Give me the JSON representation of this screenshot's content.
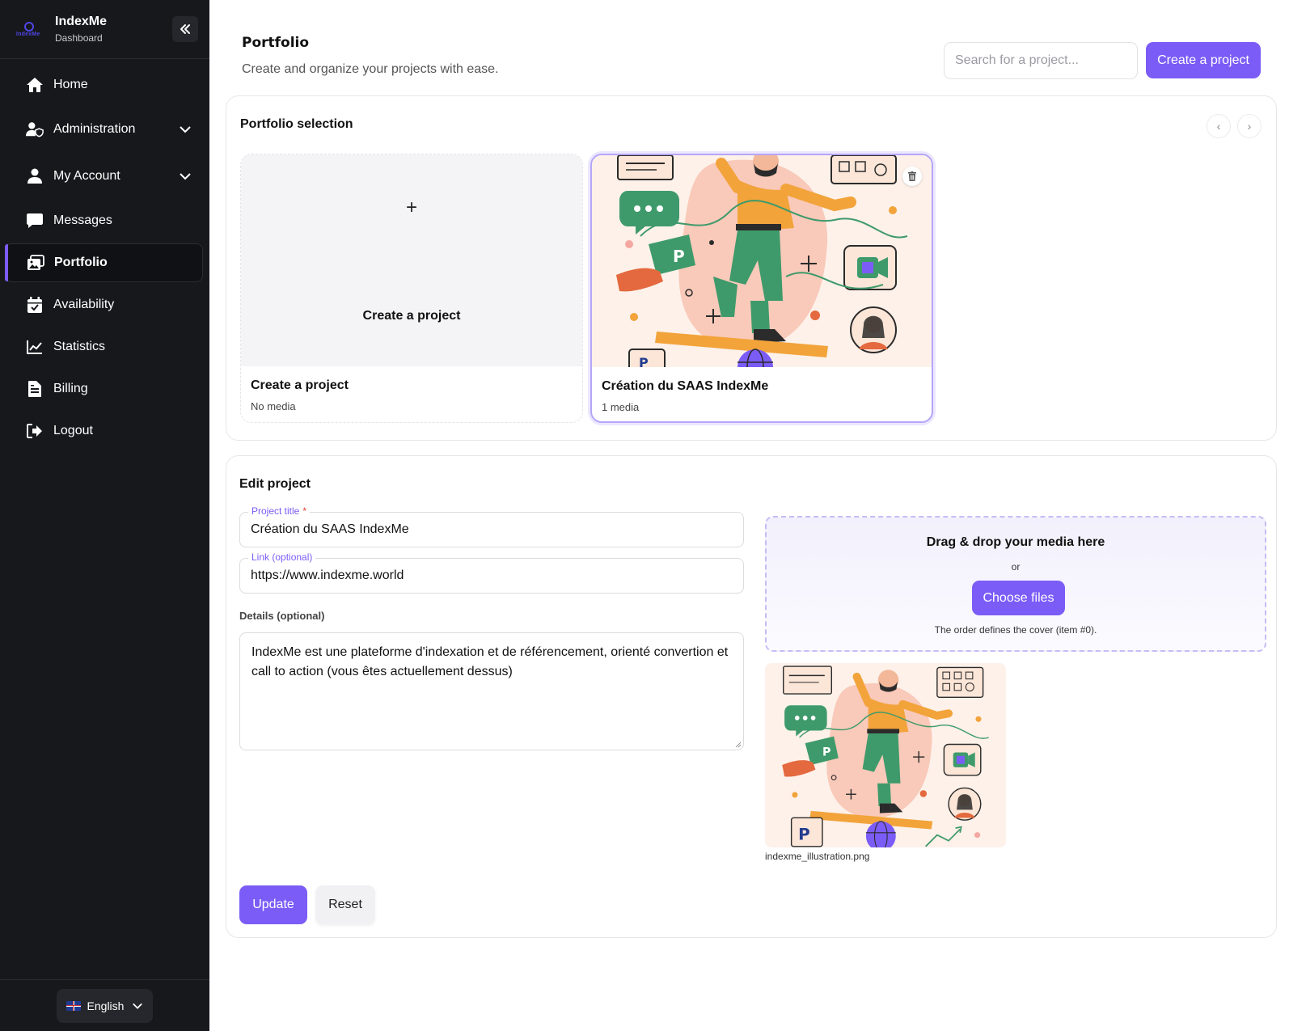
{
  "brand": {
    "name": "IndexMe",
    "subtitle": "Dashboard",
    "logo_text": "IndexMe"
  },
  "sidebar": {
    "items": [
      {
        "label": "Home",
        "icon": "home-icon"
      },
      {
        "label": "Administration",
        "icon": "user-shield-icon",
        "expandable": true
      },
      {
        "label": "My Account",
        "icon": "user-icon",
        "expandable": true
      },
      {
        "label": "Messages",
        "icon": "message-icon"
      },
      {
        "label": "Portfolio",
        "icon": "images-icon",
        "active": true
      },
      {
        "label": "Availability",
        "icon": "calendar-check-icon"
      },
      {
        "label": "Statistics",
        "icon": "chart-line-icon"
      },
      {
        "label": "Billing",
        "icon": "file-invoice-icon"
      },
      {
        "label": "Logout",
        "icon": "logout-icon"
      }
    ],
    "language": "English"
  },
  "header": {
    "title": "Portfolio",
    "subtitle": "Create and organize your projects with ease.",
    "search_placeholder": "Search for a project...",
    "create_label": "Create a project"
  },
  "selection": {
    "title": "Portfolio selection",
    "new_tile": {
      "center_label": "Create a project",
      "name": "Create a project",
      "meta": "No media"
    },
    "project_tile": {
      "name": "Création du SAAS IndexMe",
      "meta": "1 media"
    }
  },
  "edit": {
    "title": "Edit project",
    "project_title_label": "Project title",
    "project_title_required": "*",
    "project_title_value": "Création du SAAS IndexMe",
    "link_label": "Link (optional)",
    "link_value": "https://www.indexme.world",
    "details_label": "Details (optional)",
    "details_value": "IndexMe est une plateforme d'indexation et de référencement, orienté convertion et call to action (vous êtes actuellement dessus)",
    "dropzone": {
      "title": "Drag & drop your media here",
      "or": "or",
      "choose_label": "Choose files",
      "note": "The order defines the cover (item #0)."
    },
    "media_file": "indexme_illustration.png",
    "update_label": "Update",
    "reset_label": "Reset"
  },
  "colors": {
    "accent": "#7b5cf6",
    "sidebar_bg": "#17181c",
    "illustration_bg": "#fdf1e9"
  }
}
